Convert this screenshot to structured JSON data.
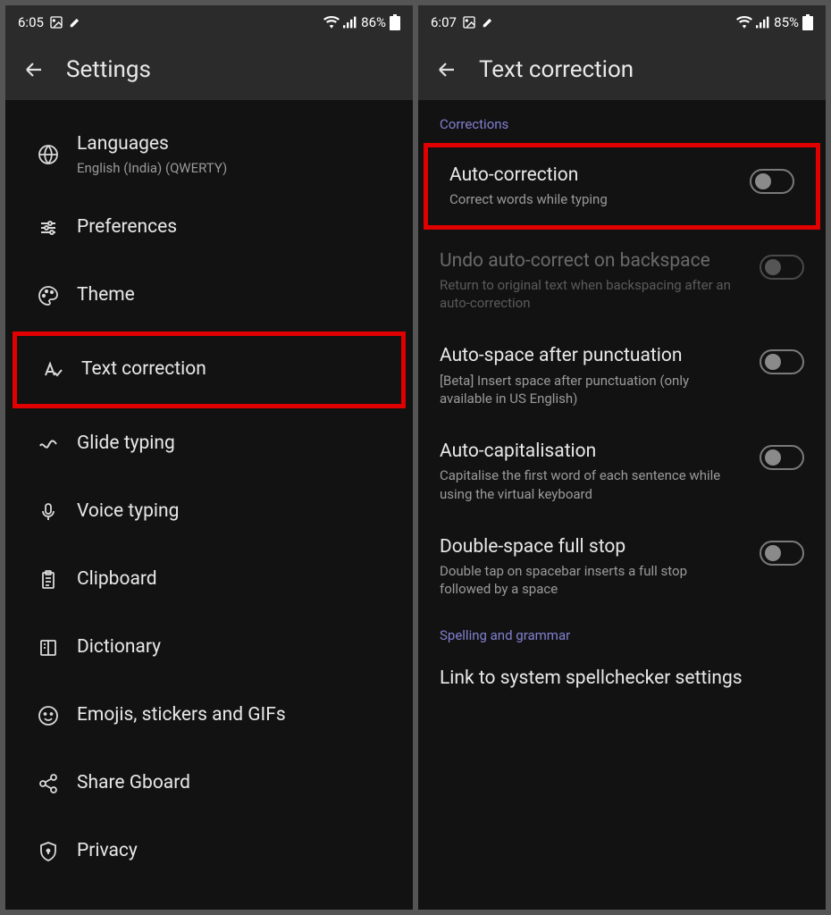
{
  "left": {
    "status": {
      "time": "6:05",
      "battery": "86%"
    },
    "header": "Settings",
    "items": [
      {
        "title": "Languages",
        "sub": "English (India) (QWERTY)"
      },
      {
        "title": "Preferences"
      },
      {
        "title": "Theme"
      },
      {
        "title": "Text correction"
      },
      {
        "title": "Glide typing"
      },
      {
        "title": "Voice typing"
      },
      {
        "title": "Clipboard"
      },
      {
        "title": "Dictionary"
      },
      {
        "title": "Emojis, stickers and GIFs"
      },
      {
        "title": "Share Gboard"
      },
      {
        "title": "Privacy"
      }
    ]
  },
  "right": {
    "status": {
      "time": "6:07",
      "battery": "85%"
    },
    "header": "Text correction",
    "section1": "Corrections",
    "section2": "Spelling and grammar",
    "items": [
      {
        "title": "Auto-correction",
        "sub": "Correct words while typing"
      },
      {
        "title": "Undo auto-correct on backspace",
        "sub": "Return to original text when backspacing after an auto-correction"
      },
      {
        "title": "Auto-space after punctuation",
        "sub": "[Beta] Insert space after punctuation (only available in US English)"
      },
      {
        "title": "Auto-capitalisation",
        "sub": "Capitalise the first word of each sentence while using the virtual keyboard"
      },
      {
        "title": "Double-space full stop",
        "sub": "Double tap on spacebar inserts a full stop followed by a space"
      },
      {
        "title": "Link to system spellchecker settings"
      }
    ]
  }
}
